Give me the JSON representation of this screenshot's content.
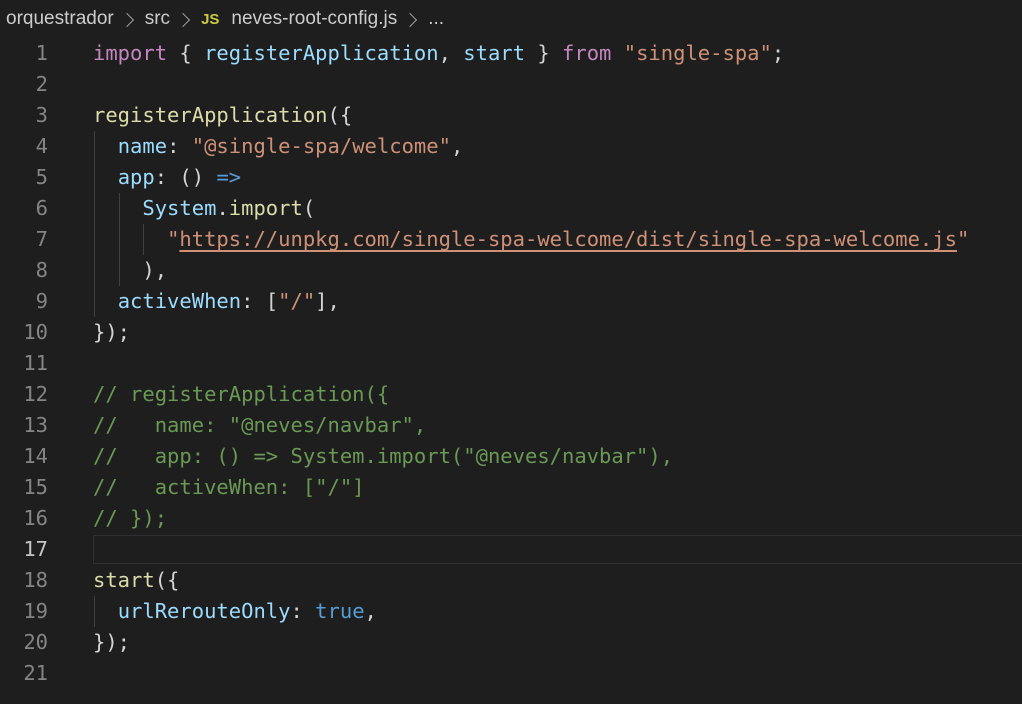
{
  "breadcrumb": {
    "folder1": "orquestrador",
    "folder2": "src",
    "file_icon": "JS",
    "file": "neves-root-config.js",
    "ellipsis": "..."
  },
  "editor": {
    "active_line": 17,
    "lines": [
      {
        "n": "1",
        "guides": [],
        "tokens": [
          [
            "kw",
            "import"
          ],
          [
            "pun",
            " { "
          ],
          [
            "vr",
            "registerApplication"
          ],
          [
            "pun",
            ", "
          ],
          [
            "vr",
            "start"
          ],
          [
            "pun",
            " } "
          ],
          [
            "kw",
            "from"
          ],
          [
            "pun",
            " "
          ],
          [
            "str",
            "\"single-spa\""
          ],
          [
            "pun",
            ";"
          ]
        ]
      },
      {
        "n": "2",
        "guides": [],
        "tokens": []
      },
      {
        "n": "3",
        "guides": [],
        "tokens": [
          [
            "fn",
            "registerApplication"
          ],
          [
            "pun",
            "({"
          ]
        ]
      },
      {
        "n": "4",
        "guides": [
          1
        ],
        "tokens": [
          [
            "pun",
            "  "
          ],
          [
            "vr",
            "name"
          ],
          [
            "pun",
            ": "
          ],
          [
            "str",
            "\"@single-spa/welcome\""
          ],
          [
            "pun",
            ","
          ]
        ]
      },
      {
        "n": "5",
        "guides": [
          1
        ],
        "tokens": [
          [
            "pun",
            "  "
          ],
          [
            "vr",
            "app"
          ],
          [
            "pun",
            ": () "
          ],
          [
            "arrow",
            "=>"
          ]
        ]
      },
      {
        "n": "6",
        "guides": [
          1,
          2
        ],
        "tokens": [
          [
            "pun",
            "    "
          ],
          [
            "vr",
            "System"
          ],
          [
            "pun",
            "."
          ],
          [
            "fn",
            "import"
          ],
          [
            "pun",
            "("
          ]
        ]
      },
      {
        "n": "7",
        "guides": [
          1,
          2,
          3
        ],
        "tokens": [
          [
            "pun",
            "      "
          ],
          [
            "str",
            "\""
          ],
          [
            "url",
            "https://unpkg.com/single-spa-welcome/dist/single-spa-welcome.js"
          ],
          [
            "str",
            "\""
          ]
        ]
      },
      {
        "n": "8",
        "guides": [
          1,
          2
        ],
        "tokens": [
          [
            "pun",
            "    ),"
          ]
        ]
      },
      {
        "n": "9",
        "guides": [
          1
        ],
        "tokens": [
          [
            "pun",
            "  "
          ],
          [
            "vr",
            "activeWhen"
          ],
          [
            "pun",
            ": ["
          ],
          [
            "str",
            "\"/\""
          ],
          [
            "pun",
            "],"
          ]
        ]
      },
      {
        "n": "10",
        "guides": [],
        "tokens": [
          [
            "pun",
            "});"
          ]
        ]
      },
      {
        "n": "11",
        "guides": [],
        "tokens": []
      },
      {
        "n": "12",
        "guides": [],
        "tokens": [
          [
            "cmt",
            "// registerApplication({"
          ]
        ]
      },
      {
        "n": "13",
        "guides": [],
        "tokens": [
          [
            "cmt",
            "//   name: \"@neves/navbar\","
          ]
        ]
      },
      {
        "n": "14",
        "guides": [],
        "tokens": [
          [
            "cmt",
            "//   app: () => System.import(\"@neves/navbar\"),"
          ]
        ]
      },
      {
        "n": "15",
        "guides": [],
        "tokens": [
          [
            "cmt",
            "//   activeWhen: [\"/\"]"
          ]
        ]
      },
      {
        "n": "16",
        "guides": [],
        "tokens": [
          [
            "cmt",
            "// });"
          ]
        ]
      },
      {
        "n": "17",
        "guides": [],
        "tokens": []
      },
      {
        "n": "18",
        "guides": [],
        "tokens": [
          [
            "fn",
            "start"
          ],
          [
            "pun",
            "({"
          ]
        ]
      },
      {
        "n": "19",
        "guides": [
          1
        ],
        "tokens": [
          [
            "pun",
            "  "
          ],
          [
            "vr",
            "urlRerouteOnly"
          ],
          [
            "pun",
            ": "
          ],
          [
            "bool",
            "true"
          ],
          [
            "pun",
            ","
          ]
        ]
      },
      {
        "n": "20",
        "guides": [],
        "tokens": [
          [
            "pun",
            "});"
          ]
        ]
      },
      {
        "n": "21",
        "guides": [],
        "tokens": []
      }
    ]
  }
}
